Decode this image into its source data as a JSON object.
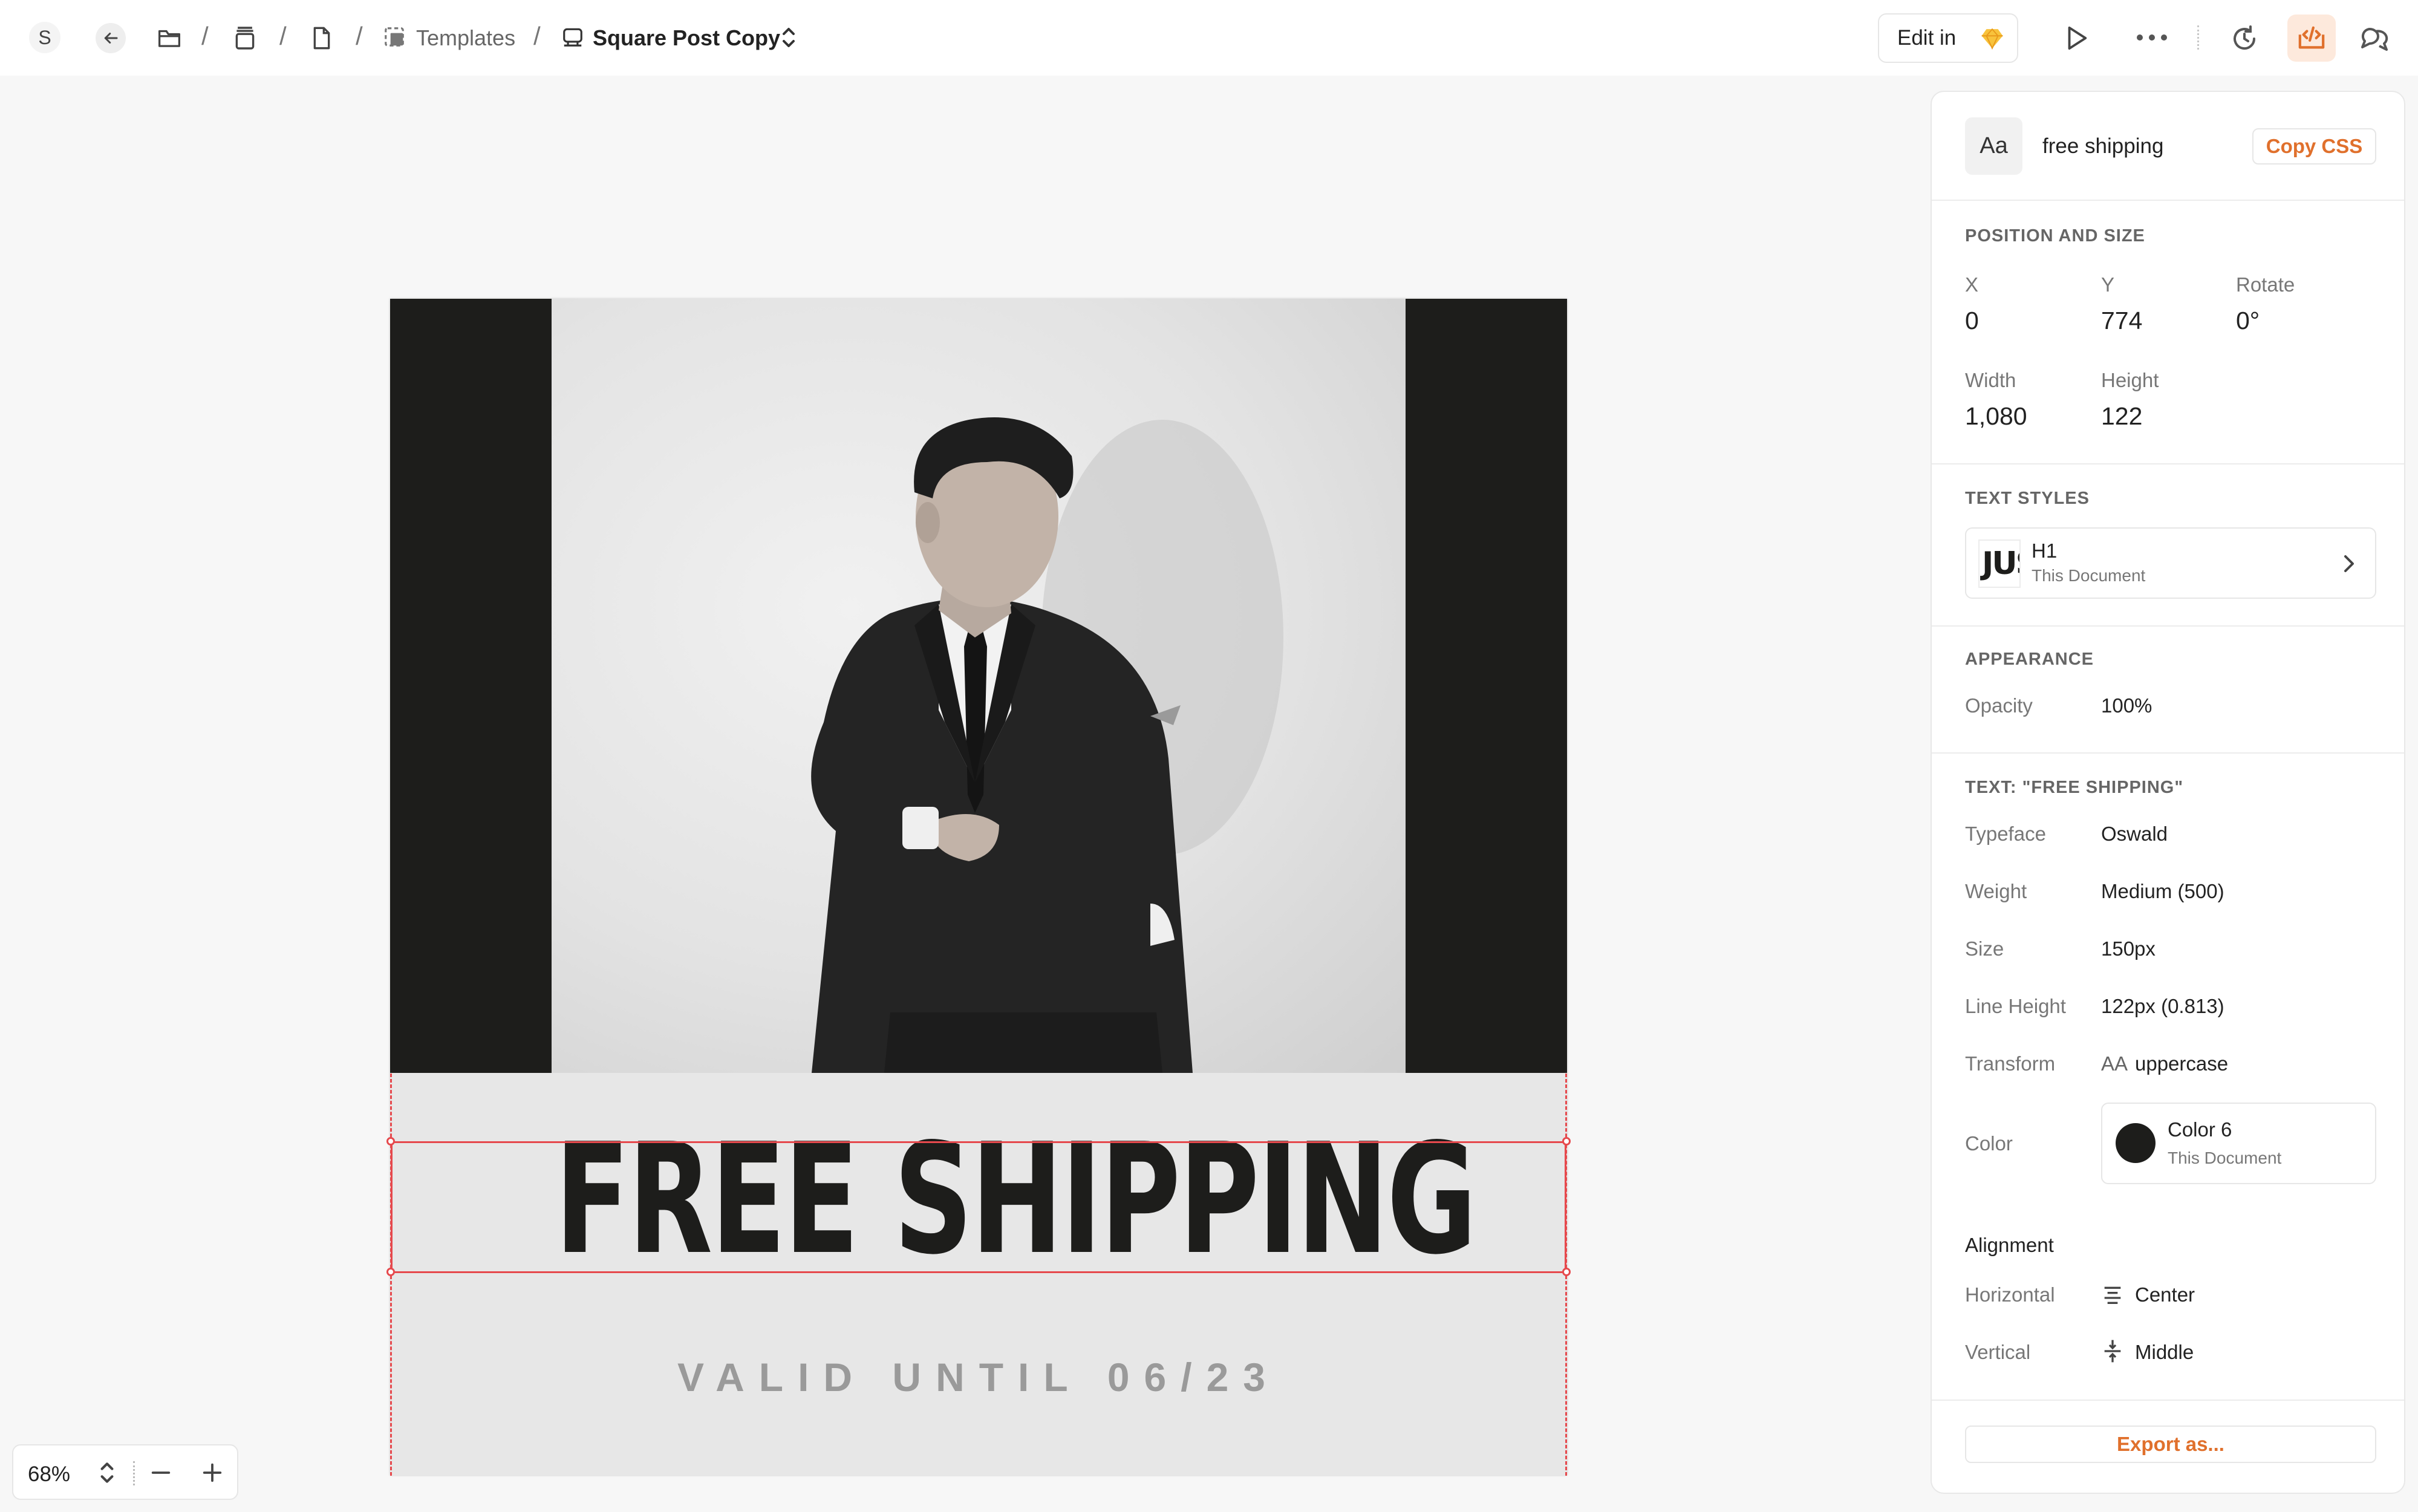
{
  "breadcrumb": {
    "avatar_letter": "S",
    "templates_label": "Templates",
    "document_title": "Square Post Copy"
  },
  "toolbar": {
    "edit_in_label": "Edit in"
  },
  "canvas": {
    "headline": "FREE SHIPPING",
    "subline": "VALID UNTIL 06/23"
  },
  "zoom": {
    "level": "68%"
  },
  "inspector": {
    "type_badge": "Aa",
    "layer_name": "free shipping",
    "copy_css_label": "Copy CSS",
    "position_and_size": {
      "heading": "POSITION AND SIZE",
      "x_label": "X",
      "x_value": "0",
      "y_label": "Y",
      "y_value": "774",
      "rotate_label": "Rotate",
      "rotate_value": "0°",
      "width_label": "Width",
      "width_value": "1,080",
      "height_label": "Height",
      "height_value": "122"
    },
    "text_styles": {
      "heading": "TEXT STYLES",
      "thumb_text": "JUS",
      "style_name": "H1",
      "style_source": "This Document"
    },
    "appearance": {
      "heading": "APPEARANCE",
      "opacity_label": "Opacity",
      "opacity_value": "100%"
    },
    "text": {
      "heading": "TEXT: \"FREE SHIPPING\"",
      "typeface_label": "Typeface",
      "typeface_value": "Oswald",
      "weight_label": "Weight",
      "weight_value": "Medium (500)",
      "size_label": "Size",
      "size_value": "150px",
      "line_height_label": "Line Height",
      "line_height_value": "122px (0.813)",
      "transform_label": "Transform",
      "transform_badge": "AA",
      "transform_value": "uppercase",
      "color_label": "Color",
      "color_name": "Color 6",
      "color_source": "This Document",
      "color_hex": "#1d1d1b"
    },
    "alignment": {
      "heading": "Alignment",
      "horizontal_label": "Horizontal",
      "horizontal_value": "Center",
      "vertical_label": "Vertical",
      "vertical_value": "Middle"
    },
    "export_label": "Export as..."
  },
  "colors": {
    "accent": "#e0702c",
    "selection": "#e6494d",
    "artboard_bg": "#e7e7e7",
    "dark": "#1d1d1b"
  },
  "icons": [
    "back-arrow-icon",
    "folder-icon",
    "project-icon",
    "page-icon",
    "templates-icon",
    "artboard-icon",
    "chevron-updown-icon",
    "sketch-gem-icon",
    "play-icon",
    "more-icon",
    "history-icon",
    "inspect-icon",
    "comments-icon",
    "chevron-right-icon",
    "align-center-icon",
    "align-middle-icon",
    "minus-icon",
    "plus-icon"
  ]
}
